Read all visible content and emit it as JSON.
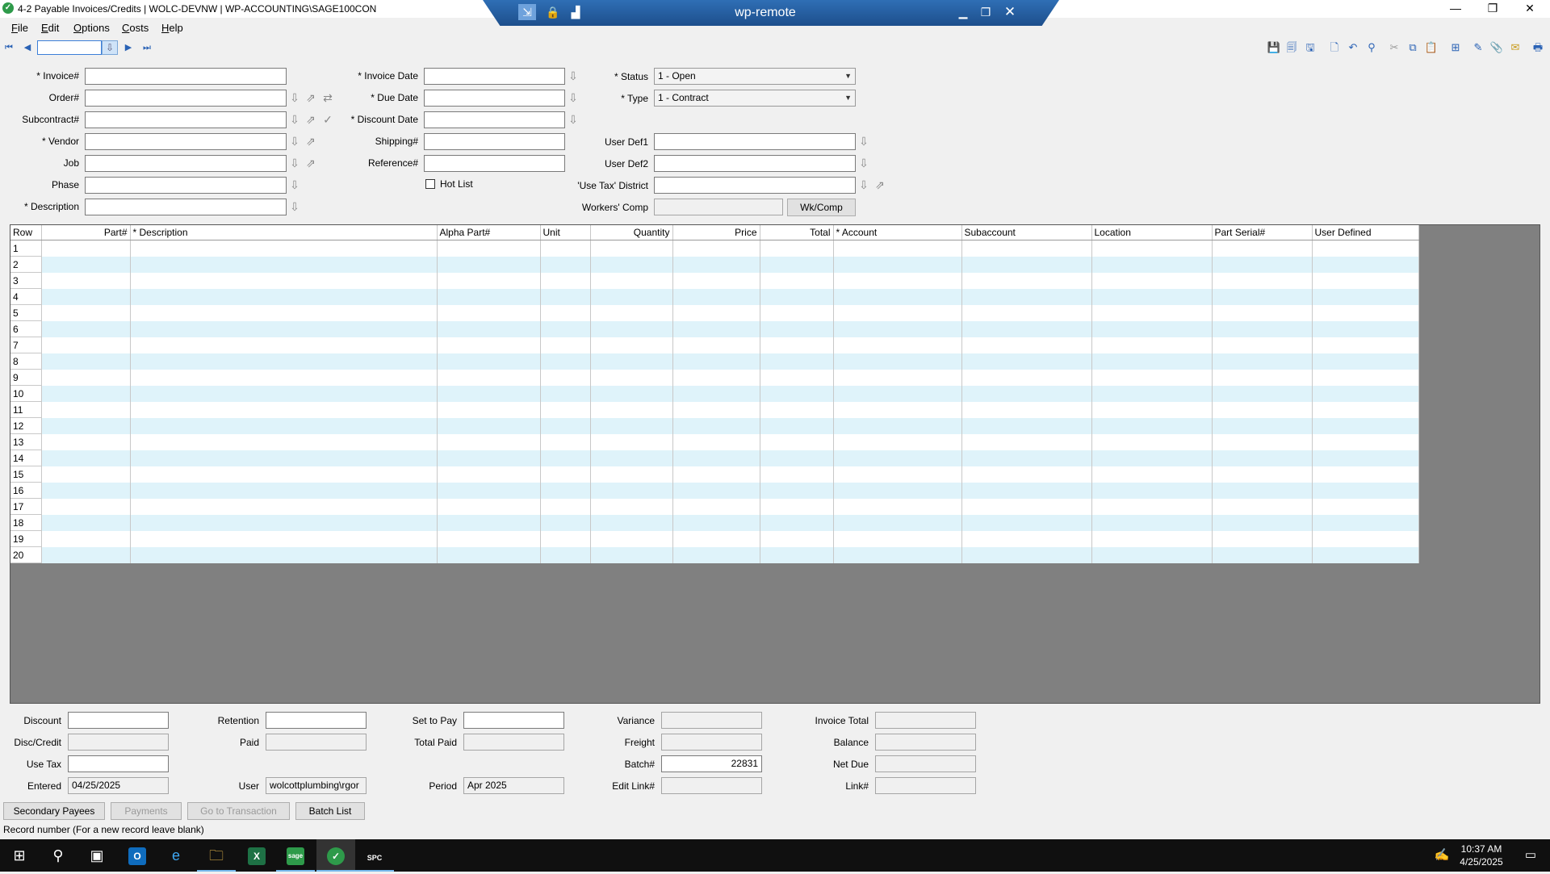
{
  "window": {
    "title": "4-2 Payable Invoices/Credits  |  WOLC-DEVNW  |  WP-ACCOUNTING\\SAGE100CON",
    "app_icon": "sage-icon",
    "minimize_icon": "minimize-icon",
    "restore_icon": "restore-icon",
    "close_icon": "close-icon"
  },
  "remote_bar": {
    "name": "wp-remote",
    "icons": [
      "pin-icon",
      "lock-icon",
      "signal-icon"
    ],
    "controls": [
      "minimize-icon",
      "restore-icon",
      "close-icon"
    ]
  },
  "menu": [
    {
      "label": "File",
      "key": "F",
      "rest": "ile"
    },
    {
      "label": "Edit",
      "key": "E",
      "rest": "dit"
    },
    {
      "label": "Options",
      "key": "O",
      "rest": "ptions"
    },
    {
      "label": "Costs",
      "key": "C",
      "rest": "osts"
    },
    {
      "label": "Help",
      "key": "H",
      "rest": "elp"
    }
  ],
  "record": {
    "value": ""
  },
  "form": {
    "invoice": {
      "label": "* Invoice#",
      "value": ""
    },
    "order": {
      "label": "Order#",
      "value": ""
    },
    "subcontract": {
      "label": "Subcontract#",
      "value": ""
    },
    "vendor": {
      "label": "* Vendor",
      "value": ""
    },
    "job": {
      "label": "Job",
      "value": ""
    },
    "phase": {
      "label": "Phase",
      "value": ""
    },
    "description": {
      "label": "* Description",
      "value": ""
    },
    "invoice_date": {
      "label": "* Invoice Date",
      "value": ""
    },
    "due_date": {
      "label": "* Due Date",
      "value": ""
    },
    "discount_date": {
      "label": "* Discount Date",
      "value": ""
    },
    "shipping": {
      "label": "Shipping#",
      "value": ""
    },
    "reference": {
      "label": "Reference#",
      "value": ""
    },
    "hot_list": {
      "label": "Hot List",
      "checked": false
    },
    "status": {
      "label": "* Status",
      "value": "1 - Open"
    },
    "type": {
      "label": "* Type",
      "value": "1 - Contract"
    },
    "user_def1": {
      "label": "User Def1",
      "value": ""
    },
    "user_def2": {
      "label": "User Def2",
      "value": ""
    },
    "use_tax_district": {
      "label": "'Use Tax' District",
      "value": ""
    },
    "workers_comp": {
      "label": "Workers' Comp",
      "value": "",
      "button": "Wk/Comp"
    }
  },
  "grid": {
    "columns": [
      "Row",
      "Part#",
      "* Description",
      "Alpha Part#",
      "Unit",
      "Quantity",
      "Price",
      "Total",
      "* Account",
      "Subaccount",
      "Location",
      "Part Serial#",
      "User Defined"
    ],
    "rows": [
      "1",
      "2",
      "3",
      "4",
      "5",
      "6",
      "7",
      "8",
      "9",
      "10",
      "11",
      "12",
      "13",
      "14",
      "15",
      "16",
      "17",
      "18",
      "19",
      "20"
    ]
  },
  "totals": {
    "discount": {
      "label": "Discount",
      "value": ""
    },
    "disc_credit": {
      "label": "Disc/Credit",
      "value": ""
    },
    "use_tax": {
      "label": "Use Tax",
      "value": ""
    },
    "entered": {
      "label": "Entered",
      "value": "04/25/2025"
    },
    "retention": {
      "label": "Retention",
      "value": ""
    },
    "paid": {
      "label": "Paid",
      "value": ""
    },
    "user": {
      "label": "User",
      "value": "wolcottplumbing\\rgor"
    },
    "set_to_pay": {
      "label": "Set to Pay",
      "value": ""
    },
    "total_paid": {
      "label": "Total Paid",
      "value": ""
    },
    "period": {
      "label": "Period",
      "value": "Apr 2025"
    },
    "variance": {
      "label": "Variance",
      "value": ""
    },
    "freight": {
      "label": "Freight",
      "value": ""
    },
    "batch": {
      "label": "Batch#",
      "value": "22831"
    },
    "edit_link": {
      "label": "Edit Link#",
      "value": ""
    },
    "invoice_total": {
      "label": "Invoice Total",
      "value": ""
    },
    "balance": {
      "label": "Balance",
      "value": ""
    },
    "net_due": {
      "label": "Net Due",
      "value": ""
    },
    "link": {
      "label": "Link#",
      "value": ""
    }
  },
  "buttons": {
    "secondary_payees": "Secondary Payees",
    "payments": "Payments",
    "go_to_transaction": "Go to Transaction",
    "batch_list": "Batch List"
  },
  "status_line": "Record number (For a new record leave blank)",
  "taskbar": {
    "time": "10:37 AM",
    "date": "4/25/2025",
    "excel_letter": "X",
    "sage_letter": "sage",
    "spc_label": "SPC"
  }
}
